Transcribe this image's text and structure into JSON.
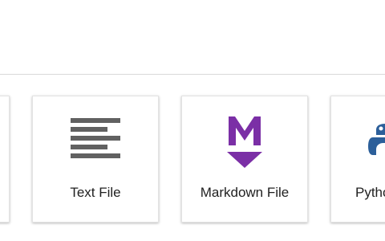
{
  "launcher": {
    "cards": [
      {
        "label": "",
        "icon": "partial-card"
      },
      {
        "label": "Text File",
        "icon": "text-file-icon"
      },
      {
        "label": "Markdown File",
        "icon": "markdown-icon"
      },
      {
        "label": "Python File",
        "icon": "python-icon"
      }
    ]
  },
  "colors": {
    "markdown": "#7b2fa6",
    "text_icon": "#616161",
    "python_blue": "#2c5f9a"
  }
}
